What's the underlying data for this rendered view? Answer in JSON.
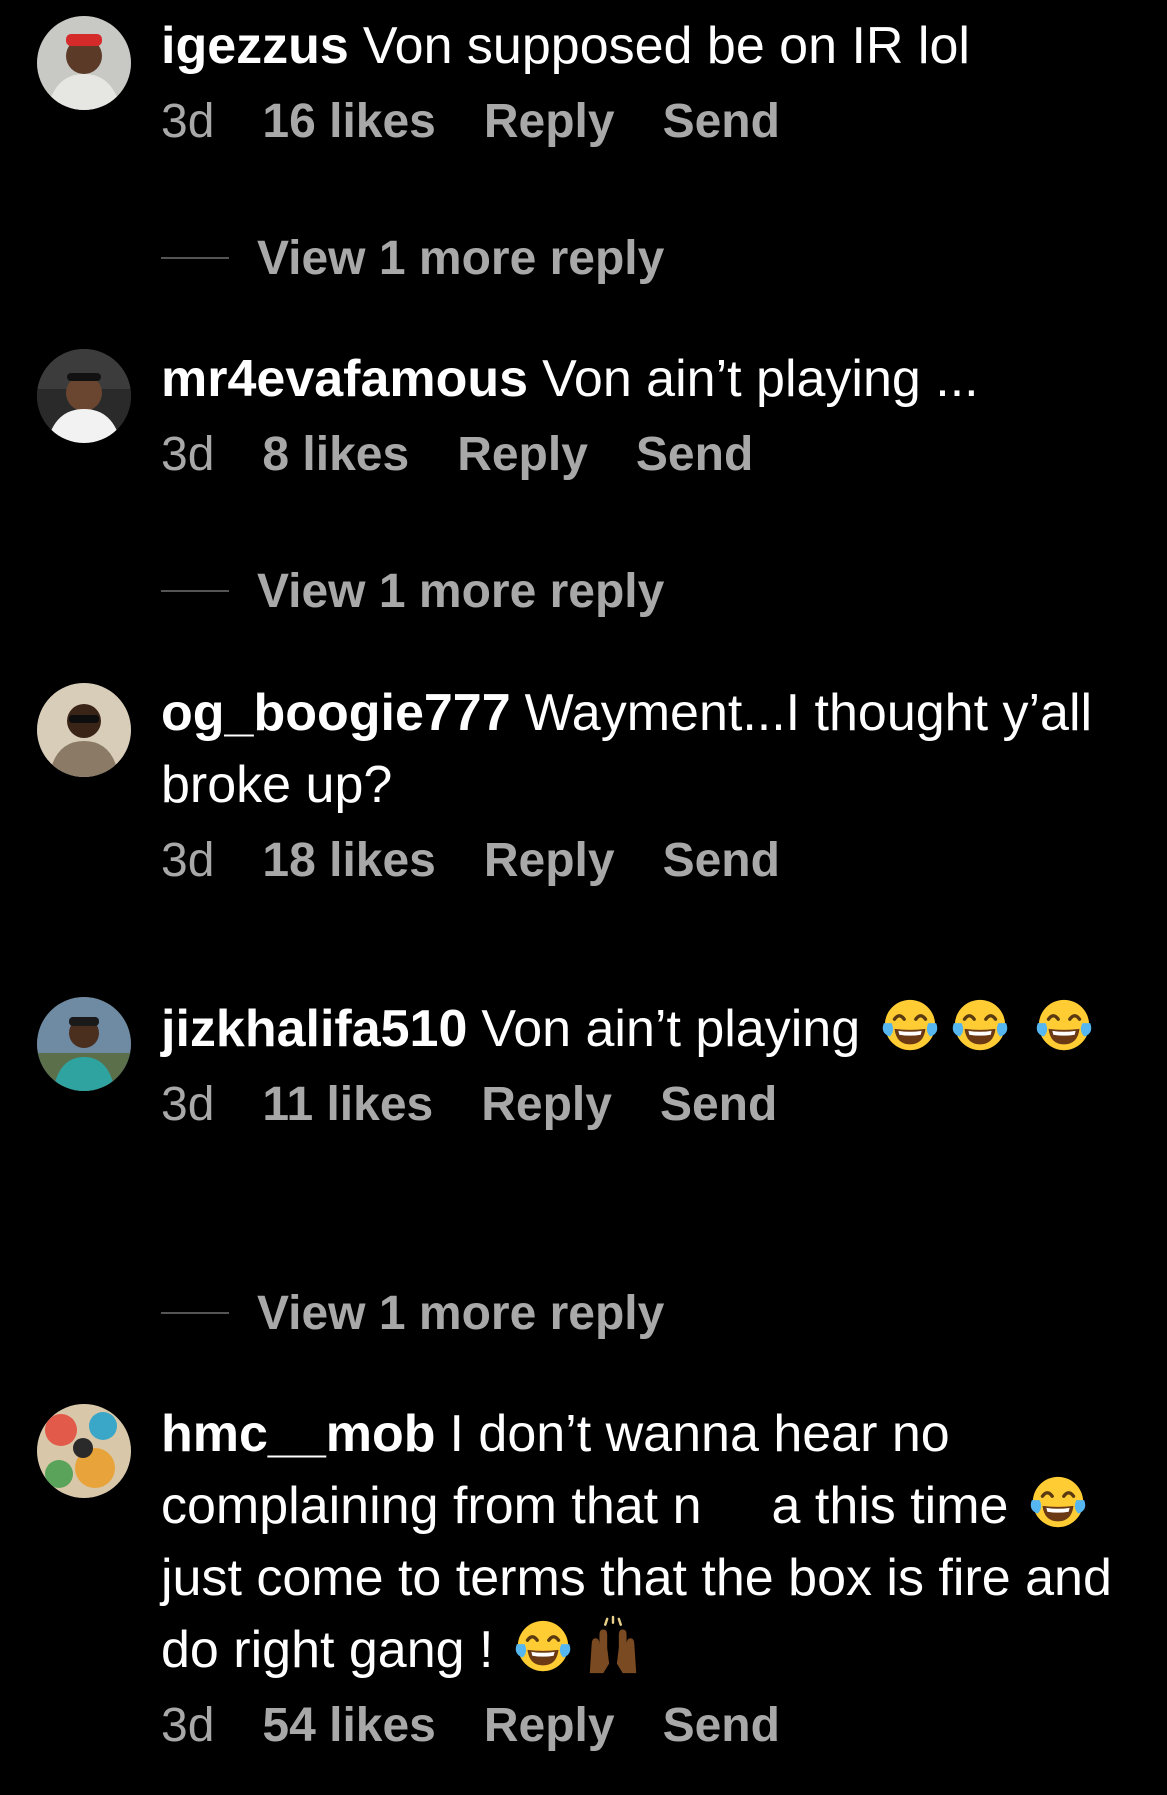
{
  "comments": [
    {
      "username": "igezzus",
      "text": "Von supposed be on IR lol",
      "time": "3d",
      "likes": "16 likes",
      "reply": "Reply",
      "send": "Send",
      "view_replies": "View 1 more reply",
      "avatar_icon": "avatar-photo-icon"
    },
    {
      "username": "mr4evafamous",
      "text": "Von ain’t playing ...",
      "time": "3d",
      "likes": "8 likes",
      "reply": "Reply",
      "send": "Send",
      "view_replies": "View 1 more reply",
      "avatar_icon": "avatar-photo-icon"
    },
    {
      "username": "og_boogie777",
      "text": "Wayment...I thought y’all broke up?",
      "time": "3d",
      "likes": "18 likes",
      "reply": "Reply",
      "send": "Send",
      "avatar_icon": "avatar-photo-icon"
    },
    {
      "username": "jizkhalifa510",
      "text": "Von ain’t playing",
      "time": "3d",
      "likes": "11 likes",
      "reply": "Reply",
      "send": "Send",
      "view_replies": "View 1 more reply",
      "avatar_icon": "avatar-photo-icon",
      "emojis": [
        "tears-of-joy-emoji",
        "tears-of-joy-emoji",
        "tears-of-joy-emoji"
      ]
    },
    {
      "username": "hmc__mob",
      "text_1": "I don’t wanna hear no complaining from that n",
      "text_2": "a this time",
      "text_3": "just come to terms that the box is fire and do right gang !",
      "time": "3d",
      "likes": "54 likes",
      "reply": "Reply",
      "send": "Send",
      "avatar_icon": "avatar-photo-icon",
      "emojis": [
        "tears-of-joy-emoji",
        "tears-of-joy-emoji",
        "raising-hands-emoji"
      ]
    }
  ],
  "colors": {
    "background": "#000000",
    "primary_text": "#ffffff",
    "secondary_text": "#a8a8a8"
  }
}
